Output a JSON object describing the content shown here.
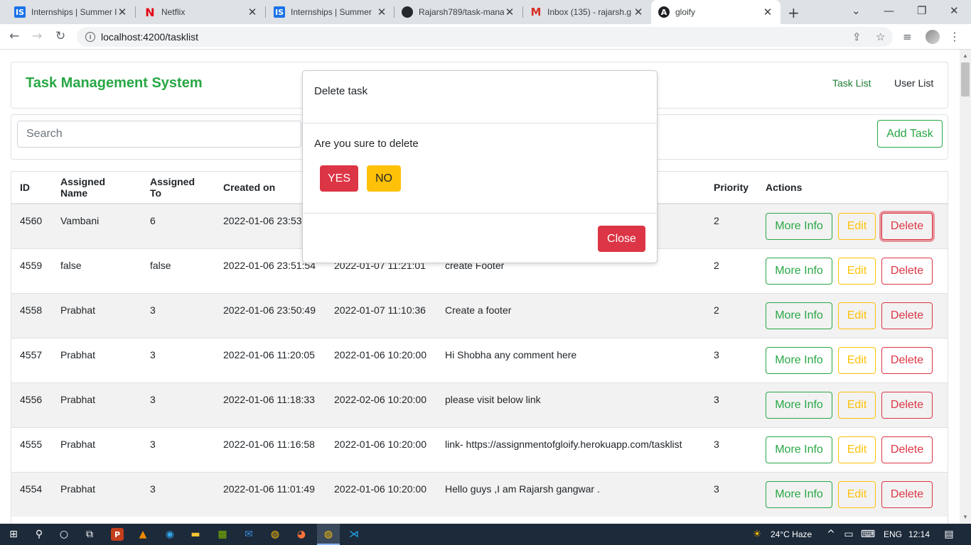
{
  "browser": {
    "tabs": [
      {
        "title": "Internships | Summer I",
        "favicon": "IS",
        "favicon_color": "#1a73e8"
      },
      {
        "title": "Netflix",
        "favicon": "N",
        "favicon_color": "#e50914"
      },
      {
        "title": "Internships | Summer",
        "favicon": "IS",
        "favicon_color": "#1a73e8"
      },
      {
        "title": "Rajarsh789/task-mana",
        "favicon": "github-icon",
        "favicon_color": "#24292e"
      },
      {
        "title": "Inbox (135) - rajarsh.g",
        "favicon": "M",
        "favicon_color": "#d93025"
      },
      {
        "title": "gloify",
        "favicon": "A",
        "favicon_color": "#202124"
      }
    ],
    "url": "localhost:4200/tasklist"
  },
  "app": {
    "brand": "Task Management System",
    "nav": {
      "tasks": "Task List",
      "users": "User List"
    },
    "search_placeholder": "Search",
    "add_task": "Add Task"
  },
  "table": {
    "headers": {
      "id": "ID",
      "name": "Assigned Name",
      "to": "Assigned To",
      "created": "Created on",
      "priority": "Priority",
      "actions": "Actions"
    },
    "more_label": "More Info",
    "edit_label": "Edit",
    "delete_label": "Delete",
    "rows": [
      {
        "id": "4560",
        "name": "Vambani",
        "to": "6",
        "created": "2022-01-06 23:53:",
        "due": "",
        "desc": "",
        "priority": "2"
      },
      {
        "id": "4559",
        "name": "false",
        "to": "false",
        "created": "2022-01-06 23:51:54",
        "due": "2022-01-07 11:21:01",
        "desc": "create Footer",
        "priority": "2"
      },
      {
        "id": "4558",
        "name": "Prabhat",
        "to": "3",
        "created": "2022-01-06 23:50:49",
        "due": "2022-01-07 11:10:36",
        "desc": "Create a footer",
        "priority": "2"
      },
      {
        "id": "4557",
        "name": "Prabhat",
        "to": "3",
        "created": "2022-01-06 11:20:05",
        "due": "2022-01-06 10:20:00",
        "desc": "Hi Shobha any comment here",
        "priority": "3"
      },
      {
        "id": "4556",
        "name": "Prabhat",
        "to": "3",
        "created": "2022-01-06 11:18:33",
        "due": "2022-02-06 10:20:00",
        "desc": "please visit below link",
        "priority": "3"
      },
      {
        "id": "4555",
        "name": "Prabhat",
        "to": "3",
        "created": "2022-01-06 11:16:58",
        "due": "2022-01-06 10:20:00",
        "desc": "link- https://assignmentofgloify.herokuapp.com/tasklist",
        "priority": "3"
      },
      {
        "id": "4554",
        "name": "Prabhat",
        "to": "3",
        "created": "2022-01-06 11:01:49",
        "due": "2022-01-06 10:20:00",
        "desc": "Hello guys ,I am Rajarsh gangwar .",
        "priority": "3"
      }
    ]
  },
  "modal": {
    "title": "Delete task",
    "question": "Are you sure to delete",
    "yes": "YES",
    "no": "NO",
    "close": "Close"
  },
  "taskbar": {
    "weather": "24°C  Haze",
    "lang": "ENG",
    "time": "12:14"
  },
  "colors": {
    "success": "#28a745",
    "warning": "#ffc107",
    "danger": "#dc3545"
  }
}
